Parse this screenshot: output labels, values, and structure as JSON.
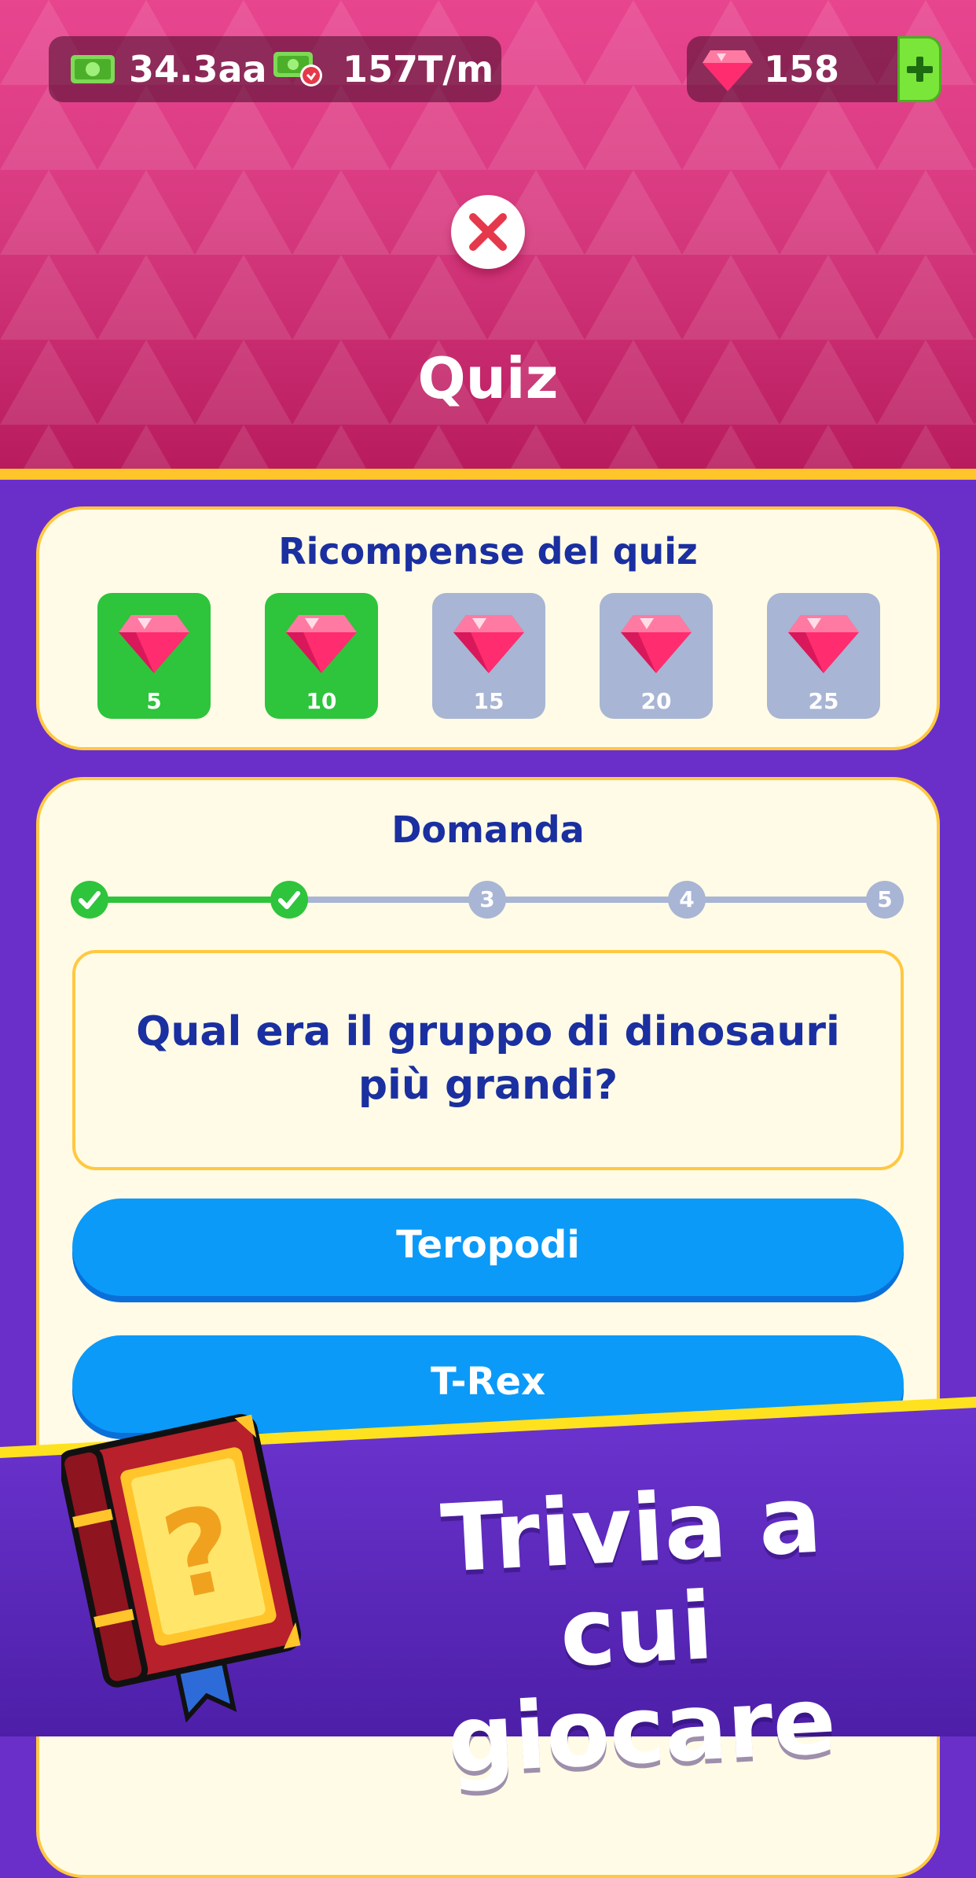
{
  "header": {
    "cash_amount": "34.3aa",
    "cash_rate": "157T/m",
    "gems": "158",
    "title": "Quiz"
  },
  "rewards": {
    "title": "Ricompense del quiz",
    "items": [
      {
        "value": "5",
        "claimed": true
      },
      {
        "value": "10",
        "claimed": true
      },
      {
        "value": "15",
        "claimed": false
      },
      {
        "value": "20",
        "claimed": false
      },
      {
        "value": "25",
        "claimed": false
      }
    ]
  },
  "question": {
    "title": "Domanda",
    "steps": [
      "",
      "",
      "3",
      "4",
      "5"
    ],
    "current_step": 3,
    "line1": "Qual era il gruppo di dinosauri",
    "line2": "più grandi?",
    "answers": [
      "Teropodi",
      "T-Rex"
    ]
  },
  "promo": {
    "line1": "Trivia a cui",
    "line2": "giocare"
  },
  "colors": {
    "header_pink": "#e8458f",
    "accent_yellow": "#ffc842",
    "success_green": "#2ec43c",
    "answer_blue": "#0b9af8",
    "text_navy": "#1a2fa0",
    "bg_purple": "#6a2fc8"
  }
}
